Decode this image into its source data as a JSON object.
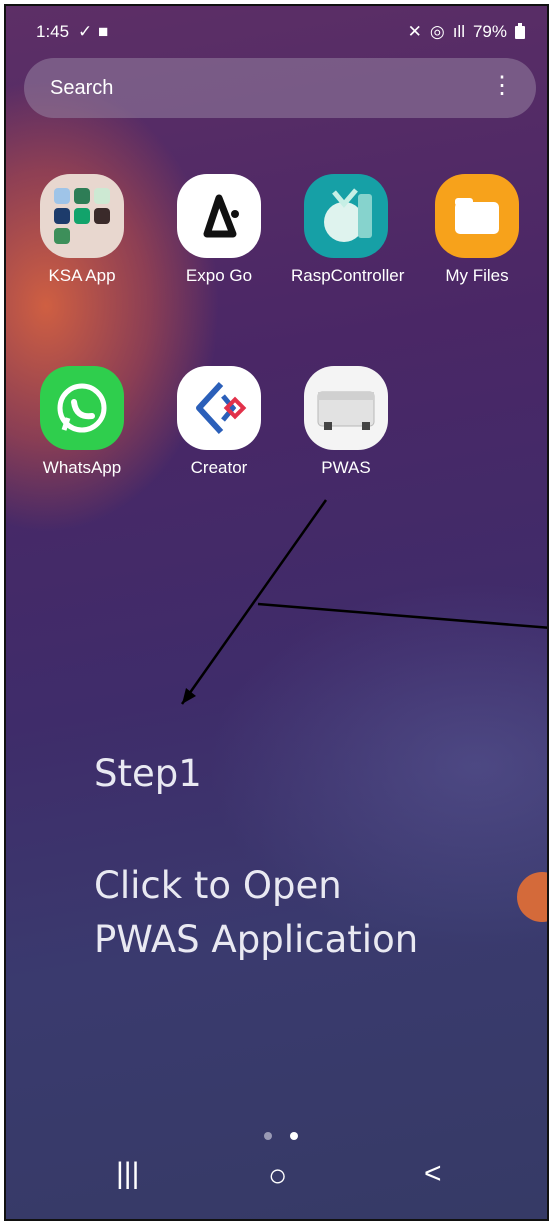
{
  "status_bar": {
    "time": "1:45",
    "battery": "79%"
  },
  "search": {
    "label": "Search"
  },
  "apps": [
    {
      "name": "KSA App"
    },
    {
      "name": "Expo Go"
    },
    {
      "name": "RaspController"
    },
    {
      "name": "My Files"
    },
    {
      "name": "WhatsApp"
    },
    {
      "name": "Creator"
    },
    {
      "name": "PWAS"
    }
  ],
  "annotation": {
    "step": "Step1",
    "line1": "Click to Open",
    "line2": "PWAS Application"
  },
  "colors": {
    "myfiles": "#f7a21b",
    "whatsapp": "#2fce4d"
  }
}
